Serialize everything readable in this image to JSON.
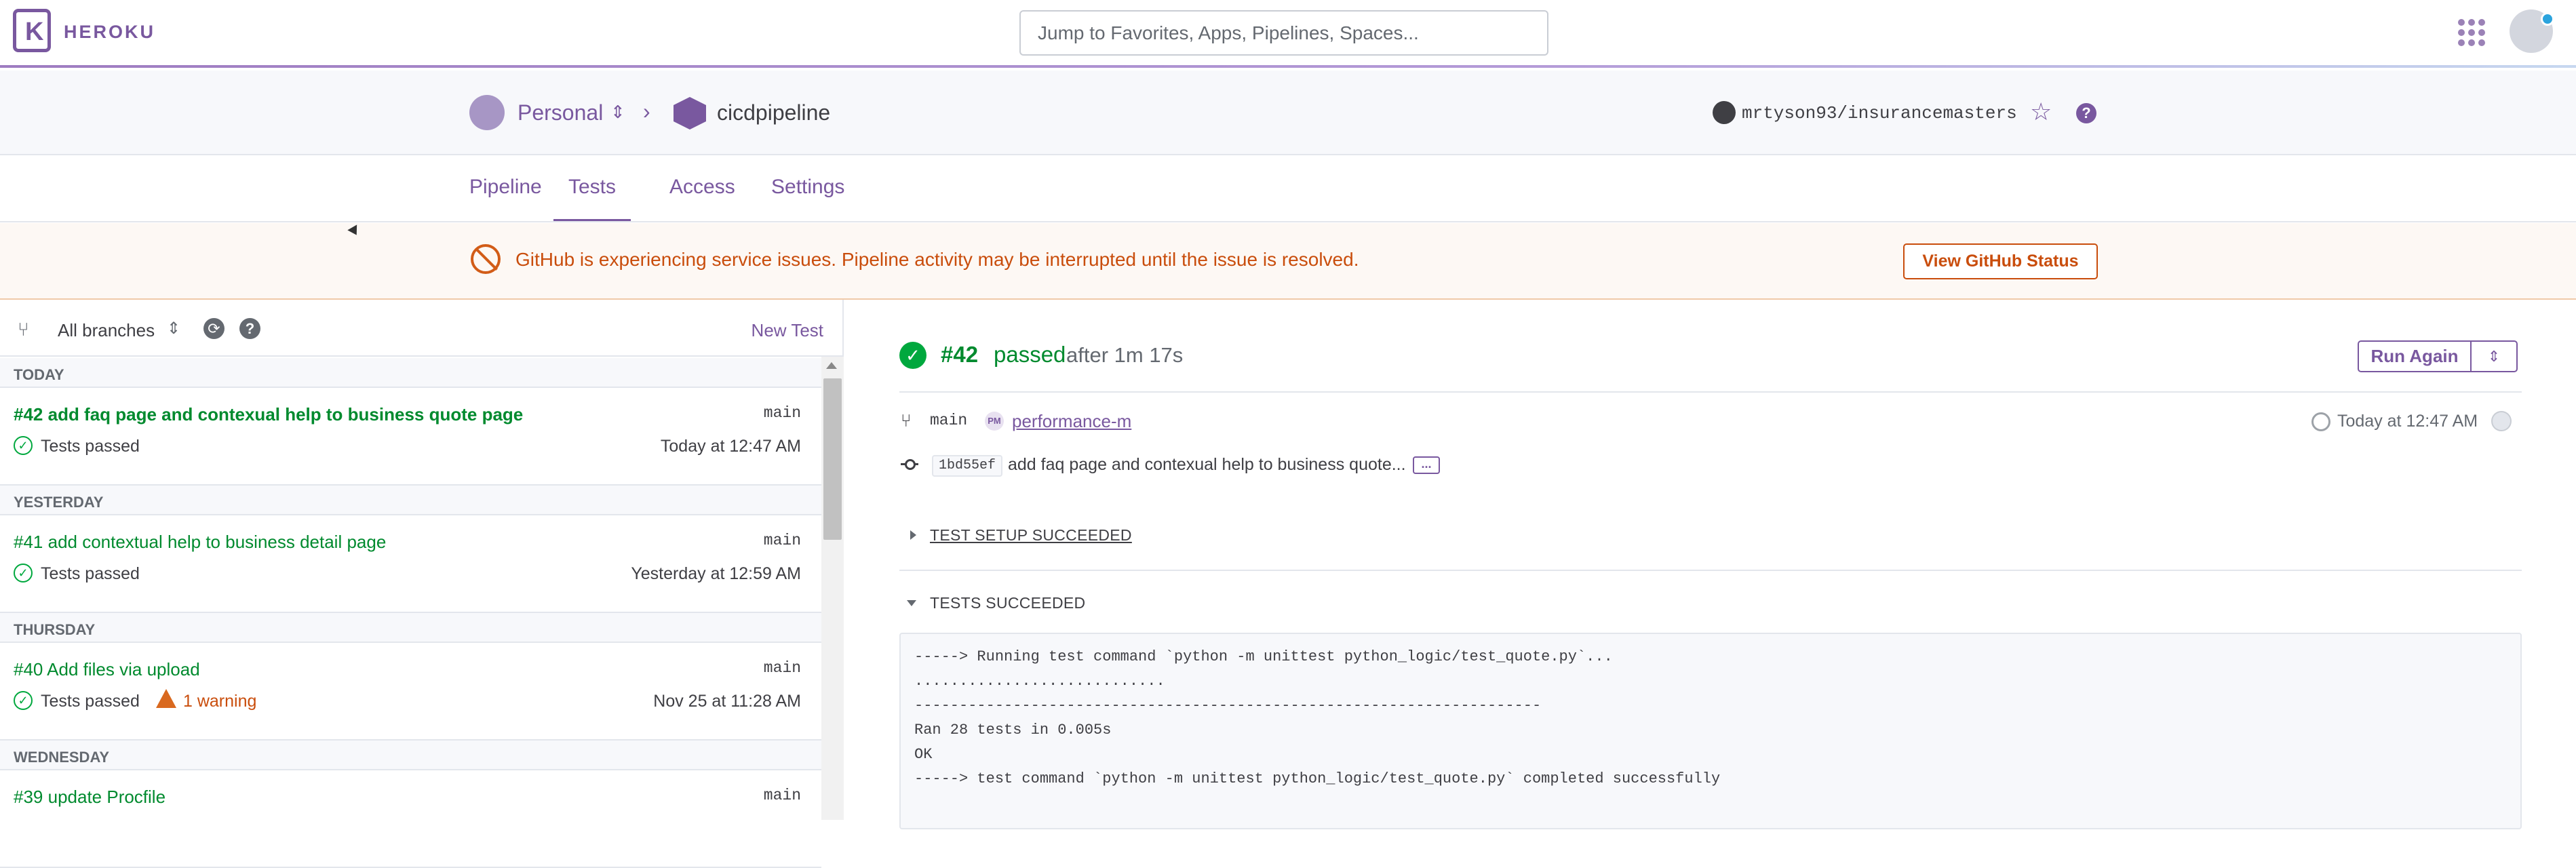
{
  "topnav": {
    "brand": "HEROKU",
    "logo_letter": "K",
    "search_placeholder": "Jump to Favorites, Apps, Pipelines, Spaces..."
  },
  "context": {
    "team": "Personal",
    "pipeline": "cicdpipeline",
    "repo": "mrtyson93/insurancemasters"
  },
  "tabs": [
    {
      "label": "Pipeline"
    },
    {
      "label": "Tests",
      "active": true
    },
    {
      "label": "Access"
    },
    {
      "label": "Settings"
    }
  ],
  "banner": {
    "message": "GitHub is experiencing service issues. Pipeline activity may be interrupted until the issue is resolved.",
    "button": "View GitHub Status"
  },
  "sidebar": {
    "branch_filter": "All branches",
    "new_test": "New Test",
    "groups": [
      {
        "day": "TODAY",
        "runs": [
          {
            "title": "#42 add faq page and contexual help to business quote page",
            "branch": "main",
            "status": "Tests passed",
            "time": "Today at 12:47 AM"
          }
        ]
      },
      {
        "day": "YESTERDAY",
        "runs": [
          {
            "title": "#41 add contextual help to business detail page",
            "branch": "main",
            "status": "Tests passed",
            "time": "Yesterday at 12:59 AM"
          }
        ]
      },
      {
        "day": "THURSDAY",
        "runs": [
          {
            "title": "#40 Add files via upload",
            "branch": "main",
            "status": "Tests passed",
            "warning": "1 warning",
            "time": "Nov 25 at 11:28 AM"
          }
        ]
      },
      {
        "day": "WEDNESDAY",
        "runs": [
          {
            "title": "#39 update Procfile",
            "branch": "main"
          }
        ]
      }
    ]
  },
  "detail": {
    "run_number": "#42",
    "status": "passed",
    "duration": "after 1m 17s",
    "run_again": "Run Again",
    "branch": "main",
    "pm_badge": "PM",
    "app_link": "performance-m",
    "time": "Today at 12:47 AM",
    "commit_sha": "1bd55ef",
    "commit_message": "add faq page and contexual help to business quote...",
    "commit_more": "...",
    "setup_section": "TEST SETUP SUCCEEDED",
    "tests_section": "TESTS SUCCEEDED",
    "console": "-----> Running test command `python -m unittest python_logic/test_quote.py`...\n............................\n----------------------------------------------------------------------\nRan 28 tests in 0.005s\nOK\n-----> test command `python -m unittest python_logic/test_quote.py` completed successfully"
  },
  "colors": {
    "brand": "#79589f",
    "success": "#008a2e",
    "warning": "#c94d0c"
  },
  "icons": [
    "apps-grid-icon",
    "user-avatar-icon",
    "github-icon",
    "star-icon",
    "help-icon",
    "branch-icon",
    "refresh-icon",
    "check-circle-icon",
    "warning-icon",
    "clock-icon",
    "commit-icon"
  ]
}
